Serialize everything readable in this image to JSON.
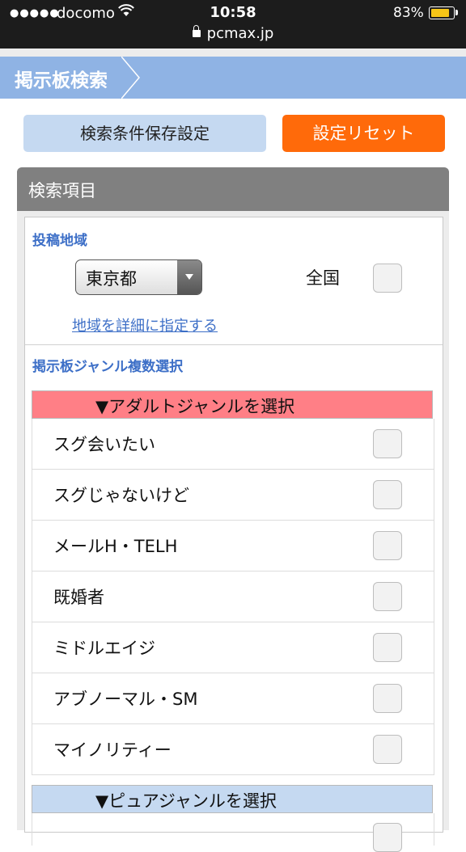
{
  "status_bar": {
    "signal_dots": "●●●●●",
    "carrier": "docomo",
    "time": "10:58",
    "battery_percent": "83%",
    "url": "pcmax.jp",
    "battery_level": 0.83
  },
  "header": {
    "breadcrumb": "掲示板検索"
  },
  "buttons": {
    "save_conditions": "検索条件保存設定",
    "reset_settings": "設定リセット"
  },
  "search_panel": {
    "title": "検索項目",
    "region": {
      "label": "投稿地域",
      "selected_prefecture": "東京都",
      "nationwide_label": "全国",
      "nationwide_checked": false,
      "detail_link": "地域を詳細に指定する"
    },
    "genre_section_label": "掲示板ジャンル複数選択",
    "adult_genre": {
      "header": "▼アダルトジャンルを選択",
      "items": [
        {
          "label": "スグ会いたい",
          "checked": false
        },
        {
          "label": "スグじゃないけど",
          "checked": false
        },
        {
          "label": "メールH・TELH",
          "checked": false
        },
        {
          "label": "既婚者",
          "checked": false
        },
        {
          "label": "ミドルエイジ",
          "checked": false
        },
        {
          "label": "アブノーマル・SM",
          "checked": false
        },
        {
          "label": "マイノリティー",
          "checked": false
        }
      ]
    },
    "pure_genre": {
      "header": "▼ピュアジャンルを選択"
    }
  },
  "colors": {
    "title_bar": "#8fb3e4",
    "save_button": "#c5d9f1",
    "reset_button": "#ff6a0a",
    "adult_header": "#ff7f86",
    "pure_header": "#c5d9f1",
    "link": "#3d6fc7"
  }
}
